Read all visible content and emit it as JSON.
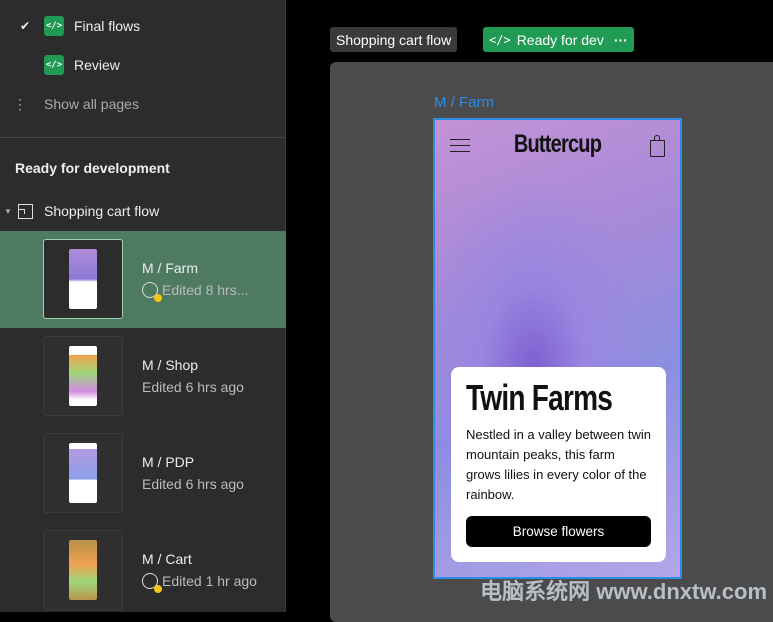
{
  "sidebar": {
    "pages": [
      {
        "label": "Final flows",
        "checked": true
      },
      {
        "label": "Review",
        "checked": false
      }
    ],
    "show_all": "Show all pages",
    "section_title": "Ready for development",
    "flow_name": "Shopping cart flow",
    "frames": [
      {
        "name": "M / Farm",
        "edited": "Edited 8 hrs...",
        "has_update": true,
        "selected": true
      },
      {
        "name": "M / Shop",
        "edited": "Edited 6 hrs ago",
        "has_update": false
      },
      {
        "name": "M / PDP",
        "edited": "Edited 6 hrs ago",
        "has_update": false
      },
      {
        "name": "M / Cart",
        "edited": "Edited 1 hr ago",
        "has_update": true
      }
    ]
  },
  "canvas": {
    "flow_tag": "Shopping cart flow",
    "status_tag": "Ready for dev",
    "frame_label": "M / Farm",
    "brand": "Buttercup",
    "headline": "Twin Farms",
    "body": "Nestled in a valley between twin mountain peaks, this farm grows lilies in every color of the rainbow.",
    "cta": "Browse flowers"
  },
  "watermark": "电脑系统网 www.dnxtw.com",
  "colors": {
    "accent_green": "#1f9b54",
    "selection": "#4f7a62",
    "frame_outline": "#2d8ce6"
  }
}
